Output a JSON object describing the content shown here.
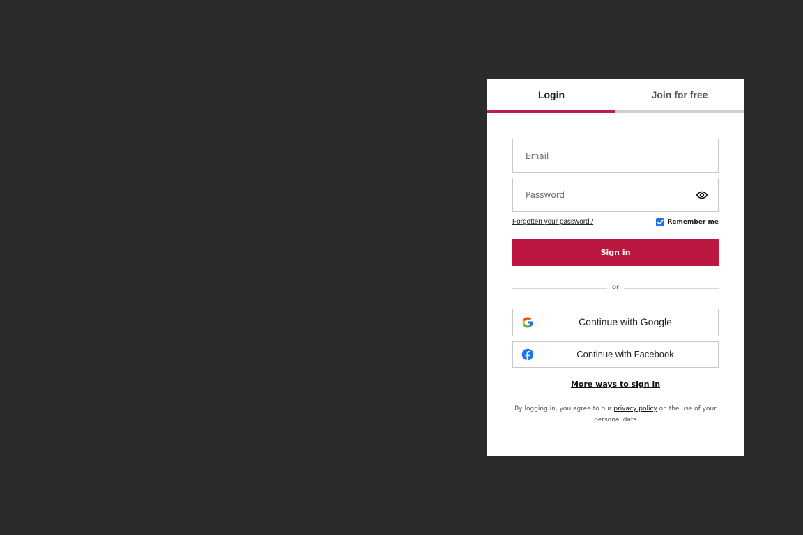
{
  "tabs": {
    "login": "Login",
    "join": "Join for free"
  },
  "form": {
    "email_placeholder": "Email",
    "email_value": "",
    "password_placeholder": "Password",
    "password_value": "",
    "forgot_password": "Forgotten your password?",
    "remember_me": "Remember me",
    "remember_me_checked": true,
    "sign_in": "Sign in"
  },
  "divider": {
    "or": "or"
  },
  "social": {
    "google": "Continue with Google",
    "facebook": "Continue with Facebook"
  },
  "more_ways": "More ways to sign in",
  "legal": {
    "prefix": "By logging in, you agree to our",
    "link": "privacy policy",
    "suffix": "on the use of your personal data"
  },
  "colors": {
    "page_background": "#2b2b2b",
    "accent": "#bb1740",
    "checkbox": "#1a73e8"
  },
  "icons": {
    "password_toggle": "eye-icon",
    "checkbox": "checkmark-icon",
    "google": "google-logo-icon",
    "facebook": "facebook-logo-icon"
  }
}
